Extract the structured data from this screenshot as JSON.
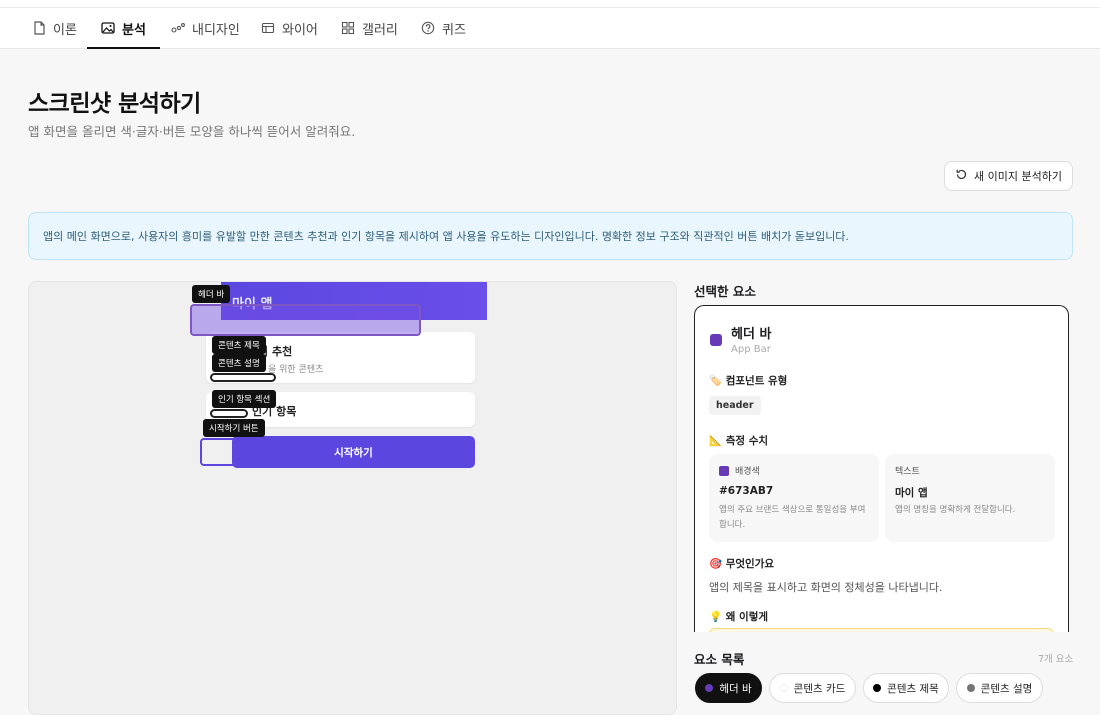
{
  "nav": {
    "tabs": [
      {
        "label": "이론",
        "icon": "document-icon"
      },
      {
        "label": "분석",
        "icon": "image-icon"
      },
      {
        "label": "내디자인",
        "icon": "nodes-icon"
      },
      {
        "label": "와이어",
        "icon": "wireframe-icon"
      },
      {
        "label": "갤러리",
        "icon": "grid-icon"
      },
      {
        "label": "퀴즈",
        "icon": "help-circle-icon"
      }
    ],
    "active": "분석"
  },
  "page": {
    "title": "스크린샷 분석하기",
    "subtitle": "앱 화면을 올리면 색·글자·버튼 모양을 하나씩 뜯어서 알려줘요.",
    "new_button": "새 이미지 분석하기"
  },
  "summary": "앱의 메인 화면으로, 사용자의 흥미를 유발할 만한 콘텐츠 추천과 인기 항목을 제시하여 앱 사용을 유도하는 디자인입니다. 명확한 정보 구조와 직관적인 버튼 배치가 돋보입니다.",
  "preview": {
    "app_title": "마이 앱",
    "card1_title": "이 추천",
    "card1_sub": "을 위한 콘텐츠",
    "card2_title": "인기 항목",
    "start_button": "시작하기",
    "tags": {
      "header": "헤더 바",
      "content_title": "콘텐츠 제목",
      "content_desc": "콘텐츠 설명",
      "popular": "인기 항목 섹션",
      "start": "시작하기 버튼"
    }
  },
  "selected": {
    "heading": "선택한 요소",
    "name": "헤더 바",
    "type_en": "App Bar",
    "color": "#673AB7",
    "component_heading": "🏷️ 컴포넌트 유형",
    "component_value": "header",
    "metrics_heading": "📐 측정 수치",
    "metrics": [
      {
        "label": "배경색",
        "value": "#673AB7",
        "desc": "앱의 주요 브랜드 색상으로 통일성을 부여합니다.",
        "has_swatch": true
      },
      {
        "label": "텍스트",
        "value": "마이 앱",
        "desc": "앱의 명칭을 명확하게 전달합니다.",
        "has_swatch": false
      }
    ],
    "what_heading": "🎯 무엇인가요",
    "what_text": "앱의 제목을 표시하고 화면의 정체성을 나타냅니다.",
    "why_heading": "💡 왜 이렇게"
  },
  "element_list": {
    "heading": "요소 목록",
    "count": "7개 요소",
    "items": [
      {
        "label": "헤더 바",
        "dot": "#673ab7"
      },
      {
        "label": "콘텐츠 카드",
        "dot": "#ffffff"
      },
      {
        "label": "콘텐츠 제목",
        "dot": "#000000"
      },
      {
        "label": "콘텐츠 설명",
        "dot": "#757575"
      }
    ]
  }
}
